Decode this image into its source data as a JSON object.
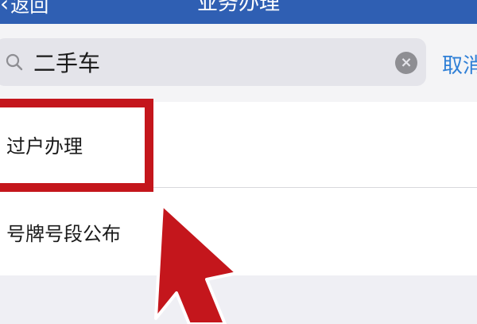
{
  "nav": {
    "back_label": "返回",
    "title": "业务办理"
  },
  "search": {
    "query": "二手车",
    "cancel_label": "取消"
  },
  "results": [
    {
      "label": "过户办理"
    },
    {
      "label": "号牌号段公布"
    }
  ],
  "colors": {
    "nav_bar": "#2f5fb3",
    "link": "#2f7fd6",
    "annotation": "#c4161c"
  },
  "icons": {
    "search": "search-icon",
    "clear": "clear-icon",
    "back": "chevron-left-icon"
  }
}
